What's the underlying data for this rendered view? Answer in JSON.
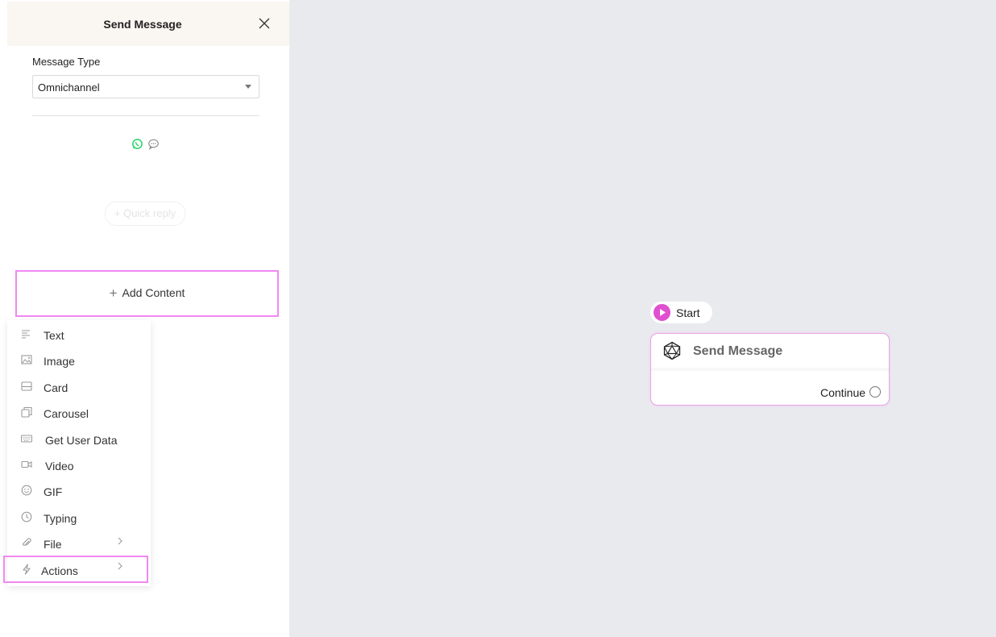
{
  "panel": {
    "title": "Send Message",
    "message_type_label": "Message Type",
    "message_type_value": "Omnichannel",
    "channels": [
      "whatsapp-icon",
      "chat-bubble-icon"
    ],
    "quick_reply_label": "+ Quick reply",
    "add_content_label": "Add Content"
  },
  "menu": {
    "items": [
      {
        "label": "Text",
        "icon": "text-lines-icon"
      },
      {
        "label": "Image",
        "icon": "image-icon"
      },
      {
        "label": "Card",
        "icon": "card-icon"
      },
      {
        "label": "Carousel",
        "icon": "carousel-icon"
      },
      {
        "label": "Get User Data",
        "icon": "keyboard-icon"
      },
      {
        "label": "Video",
        "icon": "video-icon"
      },
      {
        "label": "GIF",
        "icon": "smiley-icon"
      },
      {
        "label": "Typing",
        "icon": "clock-icon"
      },
      {
        "label": "File",
        "icon": "paperclip-icon"
      },
      {
        "label": "Actions",
        "icon": "lightning-icon"
      }
    ]
  },
  "flow": {
    "start_label": "Start",
    "node_title": "Send Message",
    "continue_label": "Continue"
  },
  "colors": {
    "accent": "#e050d0",
    "highlight": "#f189f1",
    "canvas": "#e9eaee",
    "whatsapp": "#25d366"
  }
}
